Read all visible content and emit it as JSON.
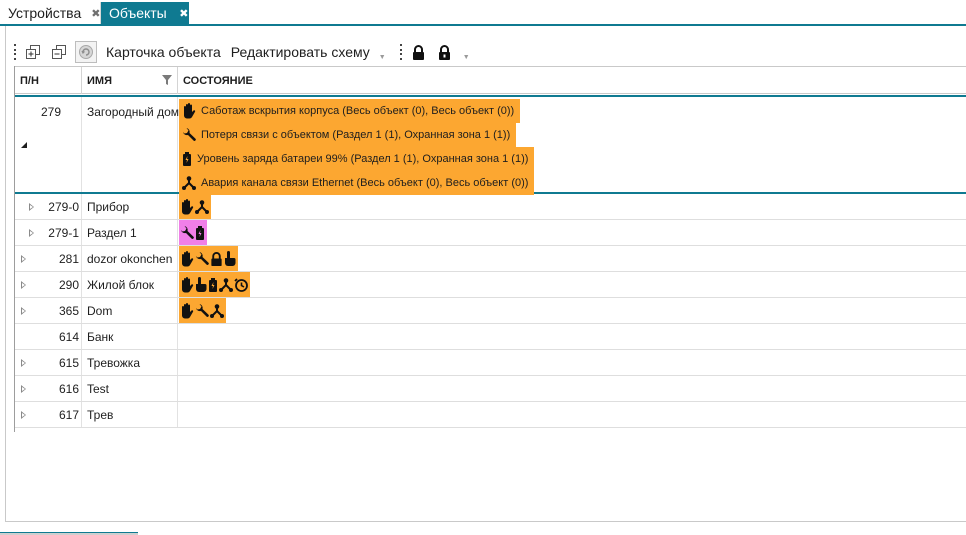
{
  "tabs": [
    {
      "label": "Устройства",
      "active": false
    },
    {
      "label": "Объекты",
      "active": true
    }
  ],
  "toolbar": {
    "card_label": "Карточка объекта",
    "edit_label": "Редактировать схему"
  },
  "columns": {
    "num": "П/Н",
    "name": "ИМЯ",
    "state": "СОСТОЯНИЕ"
  },
  "expanded": {
    "num": "279",
    "name": "Загородный дом",
    "details": [
      {
        "icon": "hand-icon",
        "text": "Саботаж вскрытия корпуса (Весь объект (0), Весь объект (0))"
      },
      {
        "icon": "wrench-icon",
        "text": "Потеря связи с объектом (Раздел 1 (1), Охранная зона 1 (1))"
      },
      {
        "icon": "battery-icon",
        "text": "Уровень заряда батареи 99% (Раздел 1 (1), Охранная зона 1 (1))"
      },
      {
        "icon": "network-icon",
        "text": "Авария канала связи Ethernet (Весь объект (0), Весь объект (0))"
      }
    ]
  },
  "rows": [
    {
      "num": "279-0",
      "name": "Прибор",
      "state_color": "#fca731",
      "icons": [
        "hand-icon",
        "network-icon"
      ]
    },
    {
      "num": "279-1",
      "name": "Раздел 1",
      "state_color": "#f07fe8",
      "icons": [
        "wrench-icon",
        "battery-icon"
      ]
    },
    {
      "num": "281",
      "name": "dozor okonchen",
      "state_color": "#fca731",
      "icons": [
        "hand-icon",
        "wrench-icon",
        "lock-icon",
        "finger-icon"
      ]
    },
    {
      "num": "290",
      "name": "Жилой блок",
      "state_color": "#fca731",
      "icons": [
        "hand-icon",
        "finger-icon",
        "battery-icon",
        "network-icon",
        "timer-icon"
      ]
    },
    {
      "num": "365",
      "name": "Dom",
      "state_color": "#fca731",
      "icons": [
        "hand-icon",
        "wrench-icon",
        "network-icon"
      ]
    },
    {
      "num": "614",
      "name": "Банк",
      "state_color": "",
      "icons": []
    },
    {
      "num": "615",
      "name": "Тревожка",
      "state_color": "",
      "icons": []
    },
    {
      "num": "616",
      "name": "Test",
      "state_color": "",
      "icons": []
    },
    {
      "num": "617",
      "name": "Трев",
      "state_color": "",
      "icons": []
    }
  ]
}
